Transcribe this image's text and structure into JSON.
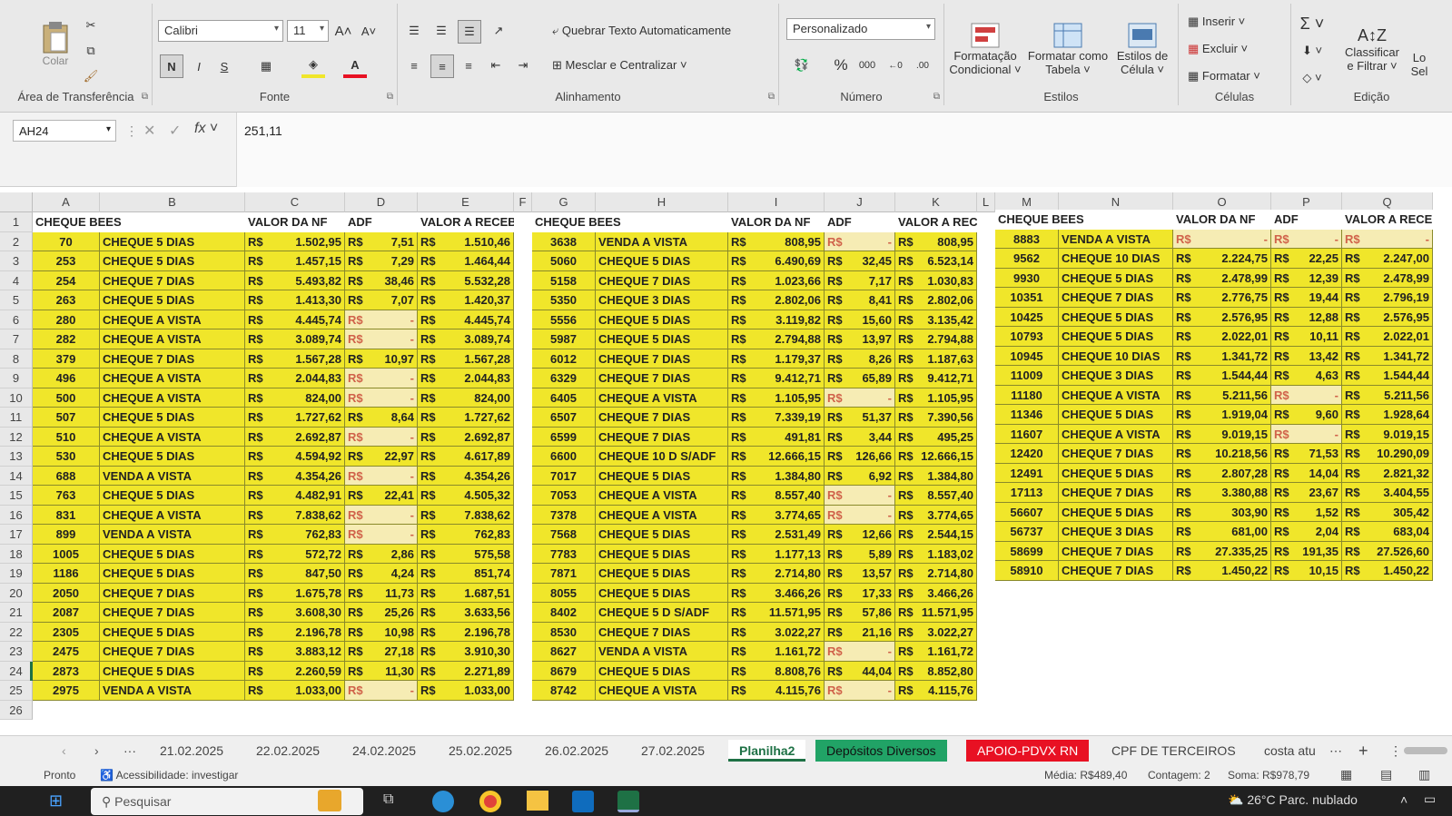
{
  "ribbon": {
    "clipboard": {
      "paste": "Colar",
      "label": "Área de Transferência"
    },
    "font": {
      "name": "Calibri",
      "size": "11",
      "bold": "N",
      "italic": "I",
      "underline": "S",
      "label": "Fonte"
    },
    "alignment": {
      "wrap": "Quebrar Texto Automaticamente",
      "merge": "Mesclar e Centralizar",
      "label": "Alinhamento"
    },
    "number": {
      "format": "Personalizado",
      "percent": "%",
      "thousands": "000",
      "label": "Número"
    },
    "styles": {
      "cond": [
        "Formatação",
        "Condicional ˅"
      ],
      "table": [
        "Formatar como",
        "Tabela ˅"
      ],
      "cell": [
        "Estilos de",
        "Célula ˅"
      ],
      "label": "Estilos"
    },
    "cells": {
      "insert": "Inserir",
      "delete": "Excluir",
      "format": "Formatar",
      "label": "Células"
    },
    "editing": {
      "sort": [
        "Classificar",
        "e Filtrar ˅"
      ],
      "find": [
        "Lo",
        "Sel"
      ],
      "label": "Edição"
    }
  },
  "formula_bar": {
    "name_box": "AH24",
    "value": "251,11"
  },
  "columns": [
    "A",
    "B",
    "C",
    "D",
    "E",
    "F",
    "G",
    "H",
    "I",
    "J",
    "K",
    "L",
    "M",
    "N",
    "O",
    "P",
    "Q"
  ],
  "rows": [
    "1",
    "2",
    "3",
    "4",
    "5",
    "6",
    "7",
    "8",
    "9",
    "10",
    "11",
    "12",
    "13",
    "14",
    "15",
    "16",
    "17",
    "18",
    "19",
    "20",
    "21",
    "22",
    "23",
    "24",
    "25",
    "26"
  ],
  "headers": {
    "cheque": "CHEQUE BEES",
    "valor": "VALOR DA NF",
    "adf": "ADF",
    "receber1": "VALOR A RECEBER",
    "receber2": "VALOR A RECEBE",
    "receber3": "VALOR A RECE"
  },
  "currency": "R$",
  "dash": "-",
  "table1": [
    [
      "70",
      "CHEQUE 5 DIAS",
      "1.502,95",
      "7,51",
      "1.510,46"
    ],
    [
      "253",
      "CHEQUE 5 DIAS",
      "1.457,15",
      "7,29",
      "1.464,44"
    ],
    [
      "254",
      "CHEQUE 7 DIAS",
      "5.493,82",
      "38,46",
      "5.532,28"
    ],
    [
      "263",
      "CHEQUE 5 DIAS",
      "1.413,30",
      "7,07",
      "1.420,37"
    ],
    [
      "280",
      "CHEQUE A VISTA",
      "4.445,74",
      "-",
      "4.445,74"
    ],
    [
      "282",
      "CHEQUE A VISTA",
      "3.089,74",
      "-",
      "3.089,74"
    ],
    [
      "379",
      "CHEQUE 7 DIAS",
      "1.567,28",
      "10,97",
      "1.567,28"
    ],
    [
      "496",
      "CHEQUE A VISTA",
      "2.044,83",
      "-",
      "2.044,83"
    ],
    [
      "500",
      "CHEQUE A VISTA",
      "824,00",
      "-",
      "824,00"
    ],
    [
      "507",
      "CHEQUE 5 DIAS",
      "1.727,62",
      "8,64",
      "1.727,62"
    ],
    [
      "510",
      "CHEQUE A VISTA",
      "2.692,87",
      "-",
      "2.692,87"
    ],
    [
      "530",
      "CHEQUE 5 DIAS",
      "4.594,92",
      "22,97",
      "4.617,89"
    ],
    [
      "688",
      "VENDA A VISTA",
      "4.354,26",
      "-",
      "4.354,26"
    ],
    [
      "763",
      "CHEQUE 5 DIAS",
      "4.482,91",
      "22,41",
      "4.505,32"
    ],
    [
      "831",
      "CHEQUE A VISTA",
      "7.838,62",
      "-",
      "7.838,62"
    ],
    [
      "899",
      "VENDA A VISTA",
      "762,83",
      "-",
      "762,83"
    ],
    [
      "1005",
      "CHEQUE 5 DIAS",
      "572,72",
      "2,86",
      "575,58"
    ],
    [
      "1186",
      "CHEQUE 5 DIAS",
      "847,50",
      "4,24",
      "851,74"
    ],
    [
      "2050",
      "CHEQUE 7 DIAS",
      "1.675,78",
      "11,73",
      "1.687,51"
    ],
    [
      "2087",
      "CHEQUE 7 DIAS",
      "3.608,30",
      "25,26",
      "3.633,56"
    ],
    [
      "2305",
      "CHEQUE 5 DIAS",
      "2.196,78",
      "10,98",
      "2.196,78"
    ],
    [
      "2475",
      "CHEQUE 7 DIAS",
      "3.883,12",
      "27,18",
      "3.910,30"
    ],
    [
      "2873",
      "CHEQUE 5 DIAS",
      "2.260,59",
      "11,30",
      "2.271,89"
    ],
    [
      "2975",
      "VENDA A VISTA",
      "1.033,00",
      "-",
      "1.033,00"
    ]
  ],
  "table2": [
    [
      "3638",
      "VENDA A VISTA",
      "808,95",
      "-",
      "808,95"
    ],
    [
      "5060",
      "CHEQUE 5 DIAS",
      "6.490,69",
      "32,45",
      "6.523,14"
    ],
    [
      "5158",
      "CHEQUE 7 DIAS",
      "1.023,66",
      "7,17",
      "1.030,83"
    ],
    [
      "5350",
      "CHEQUE 3 DIAS",
      "2.802,06",
      "8,41",
      "2.802,06"
    ],
    [
      "5556",
      "CHEQUE 5 DIAS",
      "3.119,82",
      "15,60",
      "3.135,42"
    ],
    [
      "5987",
      "CHEQUE 5 DIAS",
      "2.794,88",
      "13,97",
      "2.794,88"
    ],
    [
      "6012",
      "CHEQUE 7 DIAS",
      "1.179,37",
      "8,26",
      "1.187,63"
    ],
    [
      "6329",
      "CHEQUE 7 DIAS",
      "9.412,71",
      "65,89",
      "9.412,71"
    ],
    [
      "6405",
      "CHEQUE A VISTA",
      "1.105,95",
      "-",
      "1.105,95"
    ],
    [
      "6507",
      "CHEQUE 7 DIAS",
      "7.339,19",
      "51,37",
      "7.390,56"
    ],
    [
      "6599",
      "CHEQUE 7 DIAS",
      "491,81",
      "3,44",
      "495,25"
    ],
    [
      "6600",
      "CHEQUE 10 D S/ADF",
      "12.666,15",
      "126,66",
      "12.666,15"
    ],
    [
      "7017",
      "CHEQUE 5 DIAS",
      "1.384,80",
      "6,92",
      "1.384,80"
    ],
    [
      "7053",
      "CHEQUE A VISTA",
      "8.557,40",
      "-",
      "8.557,40"
    ],
    [
      "7378",
      "CHEQUE A VISTA",
      "3.774,65",
      "-",
      "3.774,65"
    ],
    [
      "7568",
      "CHEQUE 5 DIAS",
      "2.531,49",
      "12,66",
      "2.544,15"
    ],
    [
      "7783",
      "CHEQUE 5 DIAS",
      "1.177,13",
      "5,89",
      "1.183,02"
    ],
    [
      "7871",
      "CHEQUE 5 DIAS",
      "2.714,80",
      "13,57",
      "2.714,80"
    ],
    [
      "8055",
      "CHEQUE 5 DIAS",
      "3.466,26",
      "17,33",
      "3.466,26"
    ],
    [
      "8402",
      "CHEQUE 5 D S/ADF",
      "11.571,95",
      "57,86",
      "11.571,95"
    ],
    [
      "8530",
      "CHEQUE 7 DIAS",
      "3.022,27",
      "21,16",
      "3.022,27"
    ],
    [
      "8627",
      "VENDA A VISTA",
      "1.161,72",
      "-",
      "1.161,72"
    ],
    [
      "8679",
      "CHEQUE 5 DIAS",
      "8.808,76",
      "44,04",
      "8.852,80"
    ],
    [
      "8742",
      "CHEQUE A VISTA",
      "4.115,76",
      "-",
      "4.115,76"
    ]
  ],
  "table3": [
    [
      "8883",
      "VENDA A VISTA",
      "-",
      "-",
      "-"
    ],
    [
      "9562",
      "CHEQUE 10 DIAS",
      "2.224,75",
      "22,25",
      "2.247,00"
    ],
    [
      "9930",
      "CHEQUE 5 DIAS",
      "2.478,99",
      "12,39",
      "2.478,99"
    ],
    [
      "10351",
      "CHEQUE 7 DIAS",
      "2.776,75",
      "19,44",
      "2.796,19"
    ],
    [
      "10425",
      "CHEQUE 5 DIAS",
      "2.576,95",
      "12,88",
      "2.576,95"
    ],
    [
      "10793",
      "CHEQUE 5 DIAS",
      "2.022,01",
      "10,11",
      "2.022,01"
    ],
    [
      "10945",
      "CHEQUE 10 DIAS",
      "1.341,72",
      "13,42",
      "1.341,72"
    ],
    [
      "11009",
      "CHEQUE 3 DIAS",
      "1.544,44",
      "4,63",
      "1.544,44"
    ],
    [
      "11180",
      "CHEQUE A VISTA",
      "5.211,56",
      "-",
      "5.211,56"
    ],
    [
      "11346",
      "CHEQUE 5 DIAS",
      "1.919,04",
      "9,60",
      "1.928,64"
    ],
    [
      "11607",
      "CHEQUE A VISTA",
      "9.019,15",
      "-",
      "9.019,15"
    ],
    [
      "12420",
      "CHEQUE 7 DIAS",
      "10.218,56",
      "71,53",
      "10.290,09"
    ],
    [
      "12491",
      "CHEQUE 5 DIAS",
      "2.807,28",
      "14,04",
      "2.821,32"
    ],
    [
      "17113",
      "CHEQUE 7 DIAS",
      "3.380,88",
      "23,67",
      "3.404,55"
    ],
    [
      "56607",
      "CHEQUE 5 DIAS",
      "303,90",
      "1,52",
      "305,42"
    ],
    [
      "56737",
      "CHEQUE 3 DIAS",
      "681,00",
      "2,04",
      "683,04"
    ],
    [
      "58699",
      "CHEQUE 7 DIAS",
      "27.335,25",
      "191,35",
      "27.526,60"
    ],
    [
      "58910",
      "CHEQUE 7 DIAS",
      "1.450,22",
      "10,15",
      "1.450,22"
    ]
  ],
  "sheet_tabs": [
    "21.02.2025",
    "22.02.2025",
    "24.02.2025",
    "25.02.2025",
    "26.02.2025",
    "27.02.2025",
    "Planilha2",
    "Depósitos Diversos",
    "APOIO-PDVX RN",
    "CPF DE TERCEIROS",
    "costa atu"
  ],
  "tab_colors": {
    "depositos": "#21a366",
    "apoio": "#e81123",
    "active": "#1e7145"
  },
  "status": {
    "ready": "Pronto",
    "accessibility": "Acessibilidade: investigar",
    "media": "Média: R$489,40",
    "contagem": "Contagem: 2",
    "soma": "Soma: R$978,79"
  },
  "taskbar": {
    "search": "Pesquisar",
    "weather": "26°C  Parc. nublado"
  }
}
